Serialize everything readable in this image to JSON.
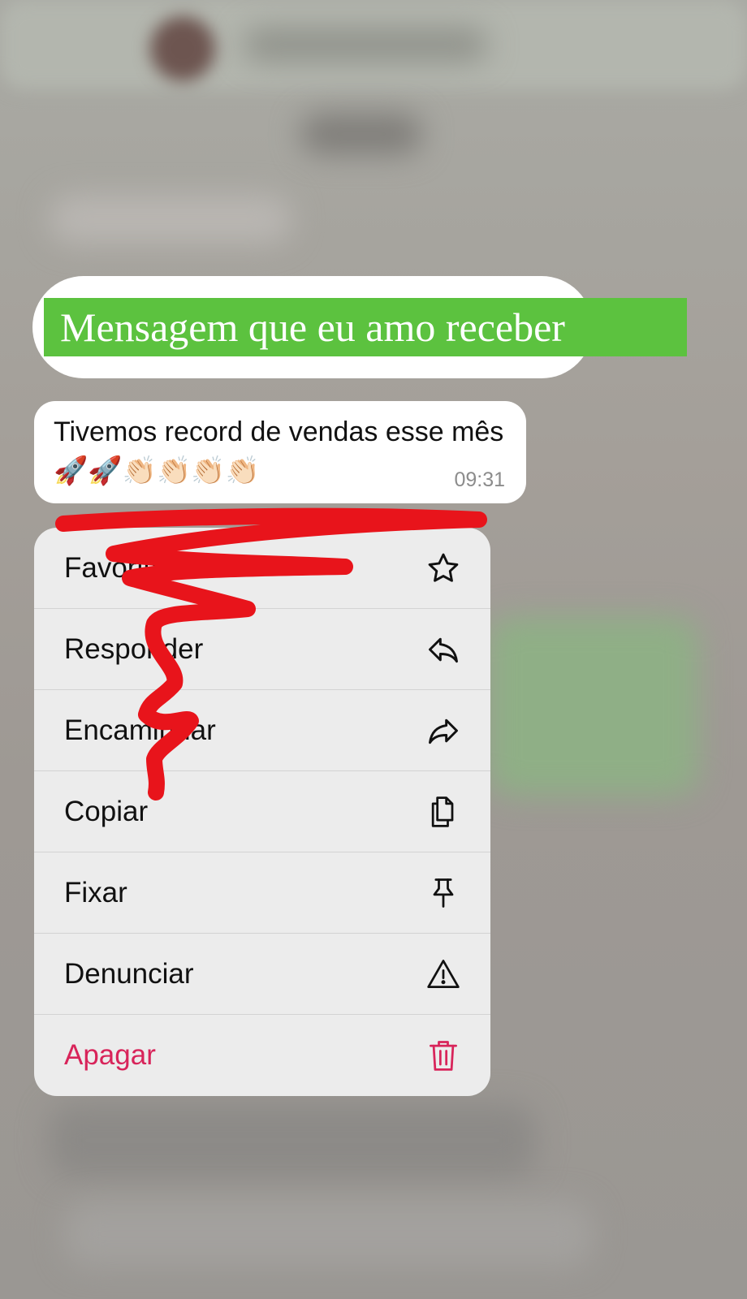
{
  "caption": {
    "text": "Mensagem que eu amo receber"
  },
  "message": {
    "text": "Tivemos record de vendas esse mês 🚀🚀👏🏻👏🏻👏🏻👏🏻",
    "time": "09:31"
  },
  "menu": {
    "items": [
      {
        "label": "Favoritar",
        "icon": "star-icon"
      },
      {
        "label": "Responder",
        "icon": "reply-icon"
      },
      {
        "label": "Encaminhar",
        "icon": "forward-icon"
      },
      {
        "label": "Copiar",
        "icon": "copy-icon"
      },
      {
        "label": "Fixar",
        "icon": "pin-icon"
      },
      {
        "label": "Denunciar",
        "icon": "warning-icon"
      },
      {
        "label": "Apagar",
        "icon": "trash-icon"
      }
    ]
  },
  "colors": {
    "caption_highlight": "#5cc23f",
    "danger": "#d8245a",
    "scribble": "#e8141b"
  }
}
